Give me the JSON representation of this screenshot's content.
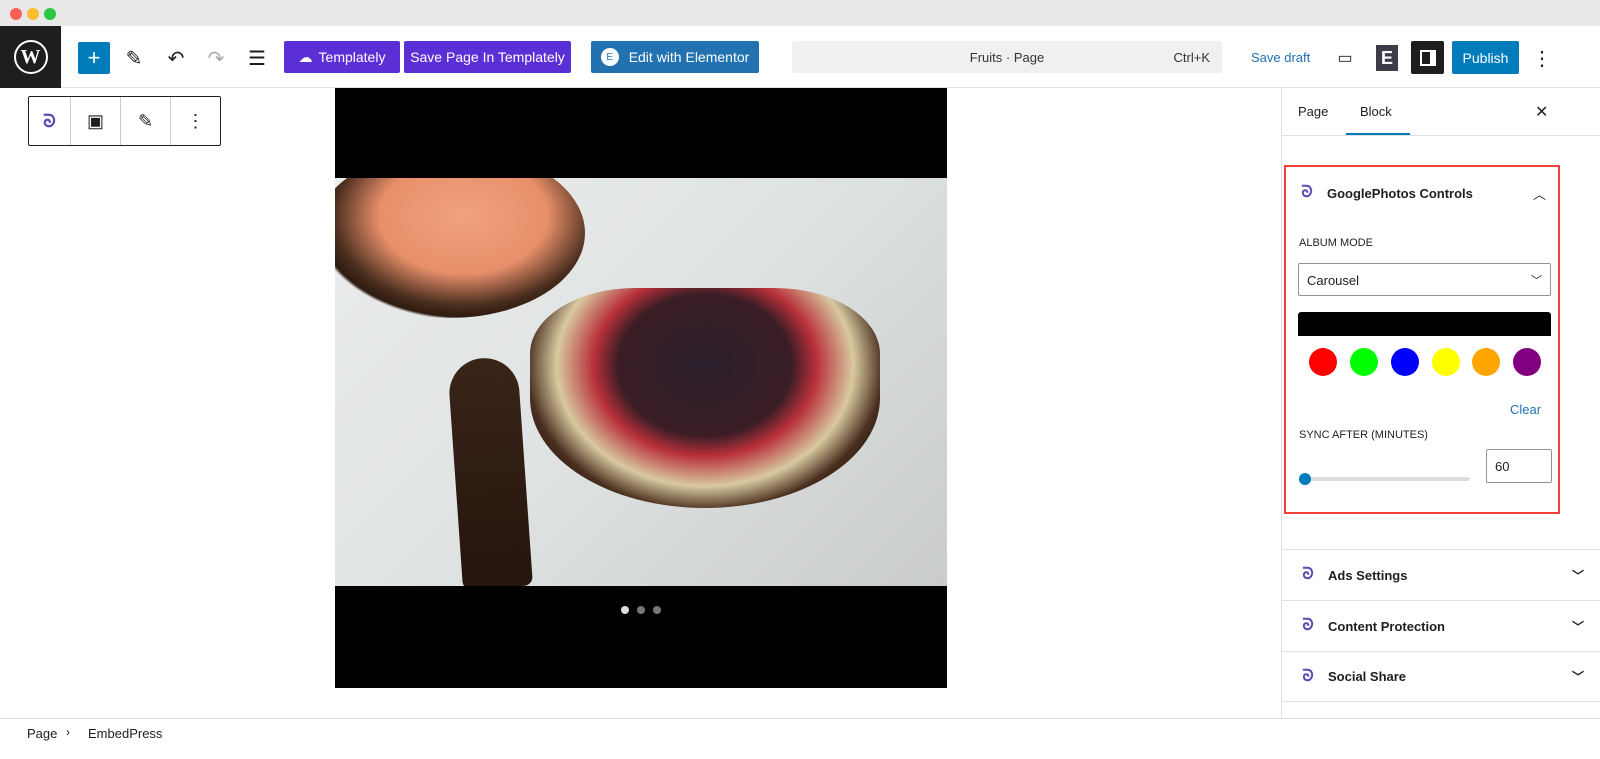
{
  "toolbar": {
    "templately": "Templately",
    "save_templately": "Save Page In Templately",
    "elementor": "Edit with Elementor",
    "command": "Fruits · Page",
    "shortcut": "Ctrl+K",
    "save_draft": "Save draft",
    "publish": "Publish"
  },
  "sidebar": {
    "tabs": [
      "Page",
      "Block"
    ],
    "active_tab": "Block",
    "panel_title": "GooglePhotos Controls",
    "album_mode_label": "ALBUM MODE",
    "album_mode": "Carousel",
    "colors": [
      "#ff0000",
      "#00ff00",
      "#0000ff",
      "#ffff00",
      "#ffa500",
      "#800080"
    ],
    "selected_color": "#000000",
    "clear": "Clear",
    "sync_label": "SYNC AFTER (MINUTES)",
    "sync_value": "60",
    "sections": [
      "Ads Settings",
      "Content Protection",
      "Social Share"
    ]
  },
  "carousel": {
    "slides": 3,
    "active_slide": 1
  },
  "breadcrumb": [
    "Page",
    "EmbedPress"
  ],
  "colors": {
    "accent": "#007cba",
    "templately": "#5b2fd6",
    "elementor": "#2271b1",
    "highlight": "#f0413a"
  }
}
